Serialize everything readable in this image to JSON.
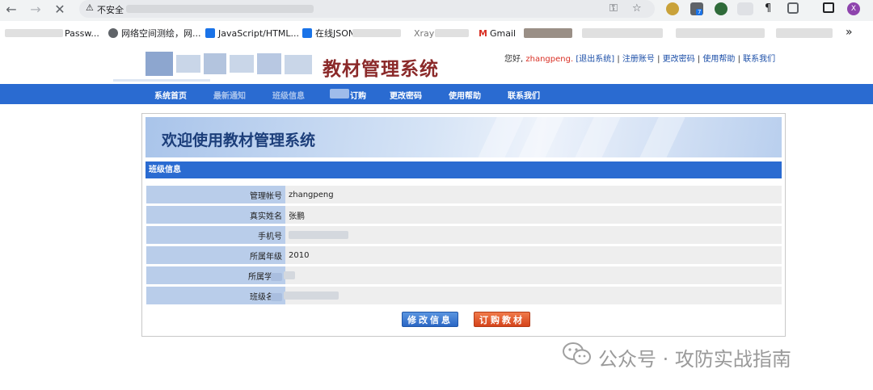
{
  "browser": {
    "security_label": "不安全",
    "bookmarks": [
      {
        "label": "Passw..."
      },
      {
        "label": "网络空间测绘，网..."
      },
      {
        "label": "JavaScript/HTML..."
      },
      {
        "label": "在线JSON"
      },
      {
        "label": "Xray"
      },
      {
        "label": "Gmail"
      }
    ],
    "extension_badge": "7",
    "profile_initial": "X",
    "more_label": "»"
  },
  "header": {
    "site_title": "教材管理系统",
    "greeting": "您好,",
    "username": "zhangpeng.",
    "logout": "[退出系统]",
    "sep": "|",
    "links": [
      "注册账号",
      "更改密码",
      "使用帮助",
      "联系我们"
    ]
  },
  "navbar": {
    "items": [
      "系统首页",
      "最新通知",
      "班级信息",
      "订购",
      "更改密码",
      "使用帮助",
      "联系我们"
    ]
  },
  "panel": {
    "banner_title": "欢迎使用教材管理系统",
    "section_title": "班级信息",
    "rows": [
      {
        "label": "管理帐号",
        "value": "zhangpeng"
      },
      {
        "label": "真实姓名",
        "value": "张鹏"
      },
      {
        "label": "手机号",
        "value": ""
      },
      {
        "label": "所属年级",
        "value": "2010"
      },
      {
        "label": "所属学",
        "value": ""
      },
      {
        "label": "班级名",
        "value": ""
      }
    ],
    "edit_button": "修改信息",
    "order_button": "订购教材"
  },
  "watermark": {
    "text": "公众号 · 攻防实战指南"
  },
  "colors": {
    "nav_blue": "#2a6bd1",
    "title_red": "#8b2a2a",
    "username_red": "#d93025",
    "label_blue": "#b9cdea"
  }
}
